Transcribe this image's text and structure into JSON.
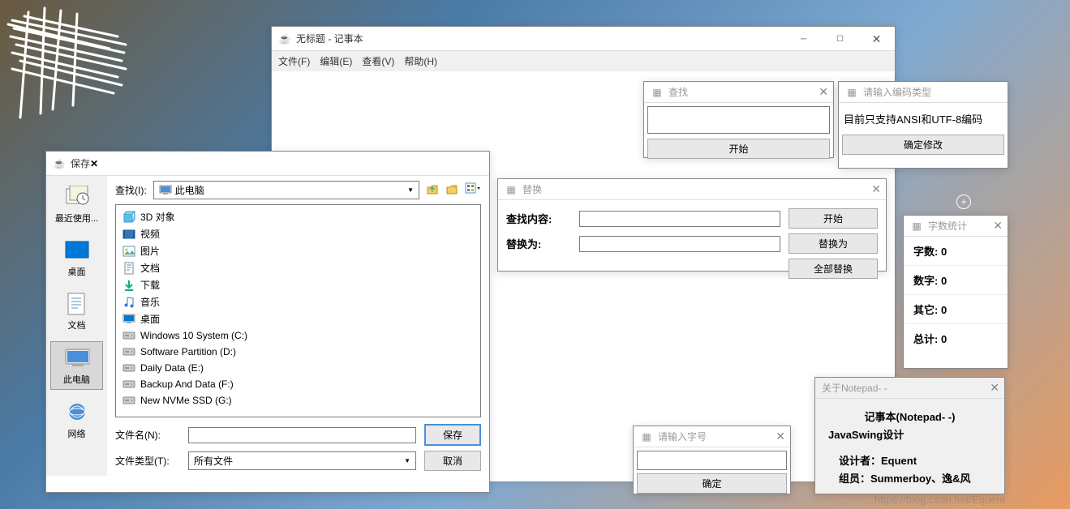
{
  "notepad": {
    "title": "无标题 - 记事本",
    "menu": {
      "file": "文件(F)",
      "edit": "编辑(E)",
      "view": "查看(V)",
      "help": "帮助(H)"
    }
  },
  "find": {
    "title": "查找",
    "start": "开始"
  },
  "encoding": {
    "title": "请输入编码类型",
    "msg": "目前只支持ANSI和UTF-8编码",
    "ok": "确定修改"
  },
  "replace": {
    "title": "替换",
    "find_label": "查找内容:",
    "repl_label": "替换为:",
    "start": "开始",
    "replace": "替换为",
    "replace_all": "全部替换"
  },
  "stats": {
    "title": "字数统计",
    "chars_label": "字数:",
    "chars": "0",
    "nums_label": "数字:",
    "nums": "0",
    "other_label": "其它:",
    "other": "0",
    "total_label": "总计:",
    "total": "0"
  },
  "fontsize": {
    "title": "请输入字号",
    "ok": "确定"
  },
  "about": {
    "title": "关于Notepad- -",
    "line1": "记事本(Notepad- -)",
    "line2": "JavaSwing设计",
    "line3": "设计者：Equent",
    "line4": "组员：Summerboy、逸&风"
  },
  "save": {
    "title": "保存",
    "lookin": "查找(I):",
    "location": "此电脑",
    "side": {
      "recent": "最近使用...",
      "desktop": "桌面",
      "docs": "文档",
      "pc": "此电脑",
      "net": "网络"
    },
    "items": [
      {
        "ico": "box3d",
        "label": "3D 对象"
      },
      {
        "ico": "film",
        "label": "视频"
      },
      {
        "ico": "pic",
        "label": "图片"
      },
      {
        "ico": "doc",
        "label": "文档"
      },
      {
        "ico": "down",
        "label": "下载"
      },
      {
        "ico": "note",
        "label": "音乐"
      },
      {
        "ico": "mon",
        "label": "桌面"
      },
      {
        "ico": "hdd",
        "label": "Windows 10 System (C:)"
      },
      {
        "ico": "hdd",
        "label": "Software Partition (D:)"
      },
      {
        "ico": "hdd",
        "label": "Daily Data (E:)"
      },
      {
        "ico": "hdd",
        "label": "Backup And Data (F:)"
      },
      {
        "ico": "hdd",
        "label": "New NVMe SSD (G:)"
      }
    ],
    "filename_label": "文件名(N):",
    "filetype_label": "文件类型(T):",
    "filetype_value": "所有文件",
    "save_btn": "保存",
    "cancel_btn": "取消"
  },
  "watermark": "https://blog.csdn.net/Equent"
}
